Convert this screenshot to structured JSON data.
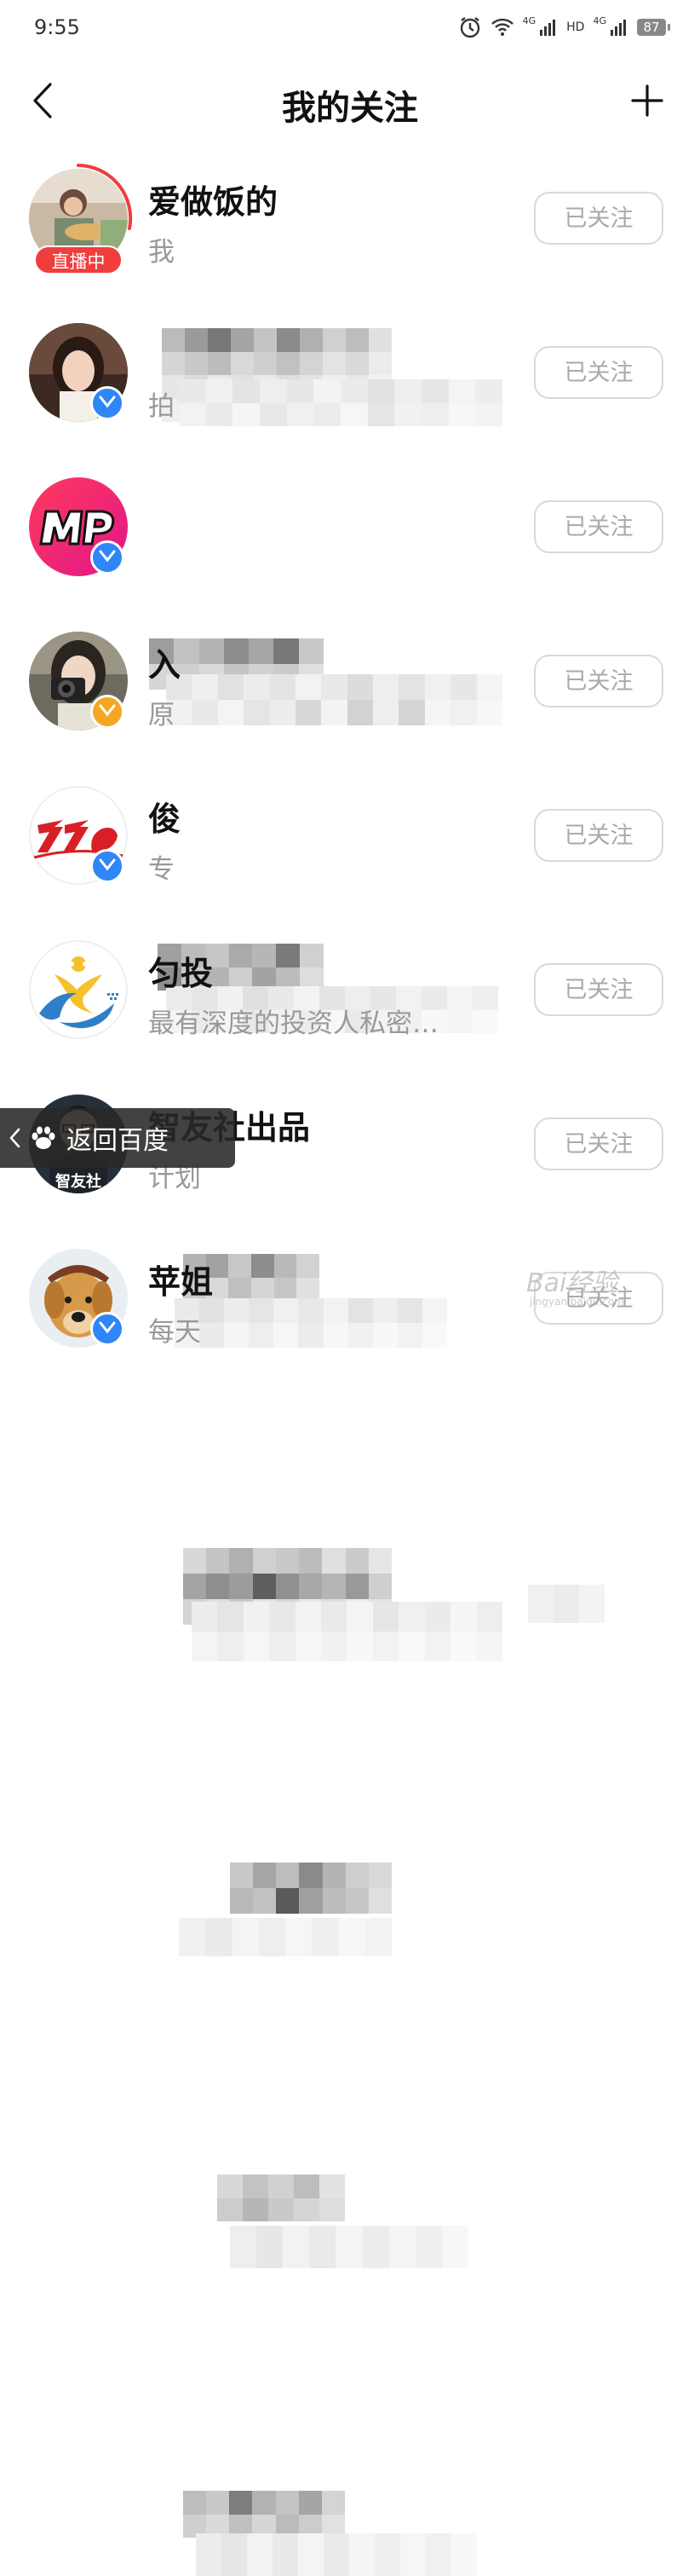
{
  "status_bar": {
    "time": "9:55",
    "network_1": "4G",
    "network_2": "4G",
    "hd": "HD",
    "battery": "87"
  },
  "header": {
    "title": "我的关注",
    "back_icon": "chevron-left-icon",
    "add_icon": "plus-icon"
  },
  "items": [
    {
      "name": "爱做饭的",
      "desc": "我",
      "live": "直播中",
      "follow": "已关注",
      "badge": "none"
    },
    {
      "name": "",
      "desc": "拍",
      "follow": "已关注",
      "badge": "blue"
    },
    {
      "name": "",
      "desc": "",
      "follow": "已关注",
      "badge": "blue"
    },
    {
      "name": "入",
      "desc": "原",
      "follow": "已关注",
      "badge": "gold"
    },
    {
      "name": "俊",
      "desc": "专",
      "follow": "已关注",
      "badge": "blue"
    },
    {
      "name": "匀投",
      "desc": "最有深度的投资人私密…",
      "follow": "已关注",
      "badge": "none"
    },
    {
      "name": "智友社出品",
      "desc": "计划",
      "follow": "已关注",
      "badge": "none",
      "avatar_text": "智友社"
    },
    {
      "name": "苹姐",
      "desc": "每天",
      "follow": "已关注",
      "badge": "blue"
    }
  ],
  "return_bar": {
    "label": "返回百度"
  },
  "watermark": {
    "main": "Bai经验",
    "sub": "jingyan.baidu.com"
  },
  "colors": {
    "live_red": "#f03d3d",
    "verified_blue": "#2f86f6",
    "verified_gold": "#f5a623",
    "follow_border": "#d9d9d9",
    "follow_text": "#aaaaaa"
  }
}
